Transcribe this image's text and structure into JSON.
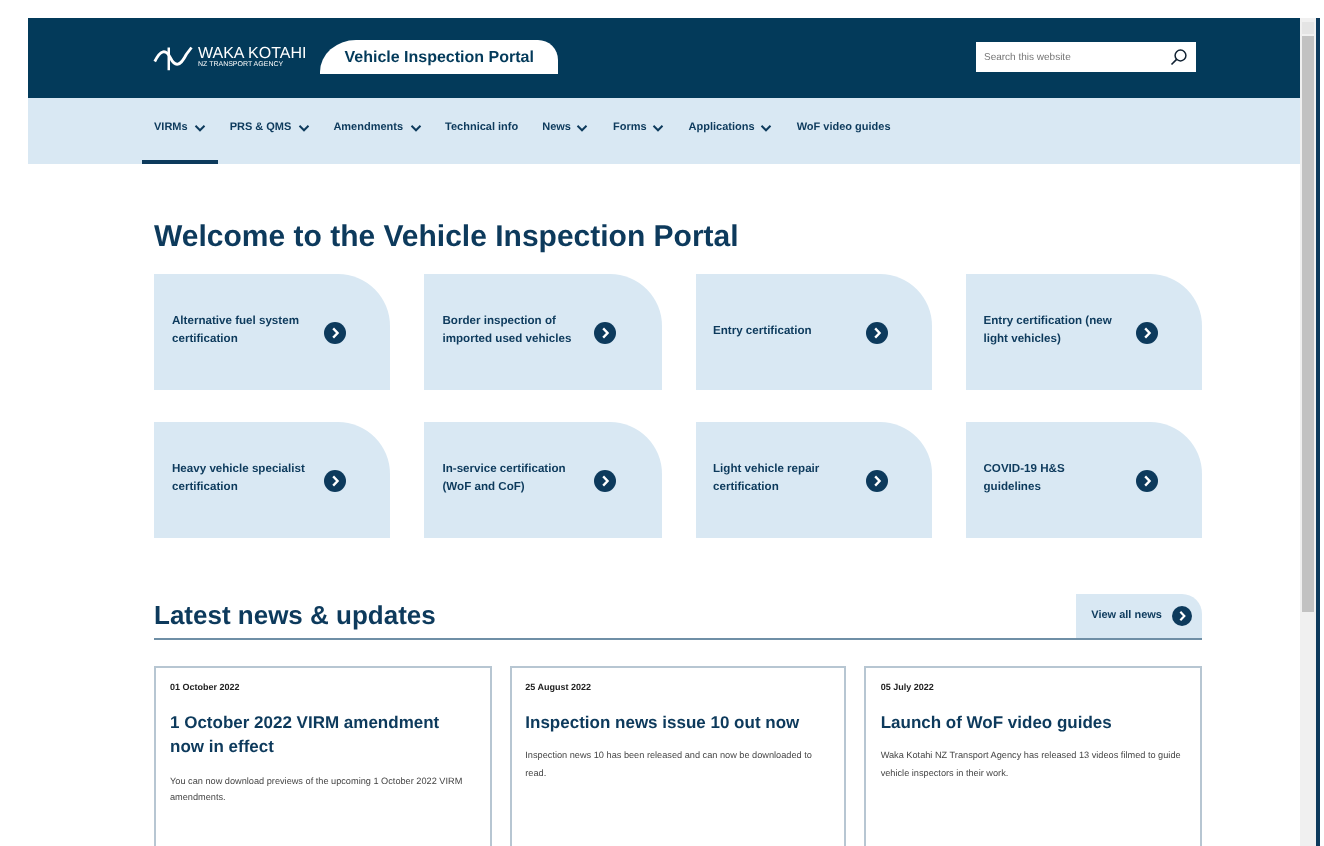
{
  "header": {
    "logo": {
      "name": "WAKA KOTAHI",
      "sub": "NZ TRANSPORT AGENCY"
    },
    "portal_title": "Vehicle Inspection Portal",
    "search": {
      "placeholder": "Search this website"
    }
  },
  "nav": [
    {
      "label": "VIRMs",
      "has_menu": true,
      "selected": true
    },
    {
      "label": "PRS & QMS",
      "has_menu": true,
      "selected": false
    },
    {
      "label": "Amendments",
      "has_menu": true,
      "selected": false
    },
    {
      "label": "Technical info",
      "has_menu": false,
      "selected": false
    },
    {
      "label": "News",
      "has_menu": true,
      "selected": false
    },
    {
      "label": "Forms",
      "has_menu": true,
      "selected": false
    },
    {
      "label": "Applications",
      "has_menu": true,
      "selected": false
    },
    {
      "label": "WoF video guides",
      "has_menu": false,
      "selected": false
    }
  ],
  "welcome": {
    "title": "Welcome to the Vehicle Inspection Portal",
    "tiles": [
      {
        "label": "Alternative fuel system certification"
      },
      {
        "label": "Border inspection of imported used vehicles"
      },
      {
        "label": "Entry certification"
      },
      {
        "label": "Entry certification (new light vehicles)"
      },
      {
        "label": "Heavy vehicle specialist certification"
      },
      {
        "label": "In-service certification (WoF and CoF)"
      },
      {
        "label": "Light vehicle repair certification"
      },
      {
        "label": "COVID-19 H&S guidelines"
      }
    ]
  },
  "news": {
    "title": "Latest news & updates",
    "view_all": "View all news",
    "items": [
      {
        "date": "01 October 2022",
        "title": "1 October 2022 VIRM amendment now in effect",
        "summary": "You can now download previews of the upcoming 1 October 2022 VIRM amendments."
      },
      {
        "date": "25 August 2022",
        "title": "Inspection news issue 10 out now",
        "summary": "Inspection news 10 has been released and can now be downloaded to read."
      },
      {
        "date": "05 July 2022",
        "title": "Launch of WoF video guides",
        "summary": "Waka Kotahi NZ Transport Agency has released 13 videos filmed to guide vehicle inspectors in their work."
      }
    ]
  }
}
